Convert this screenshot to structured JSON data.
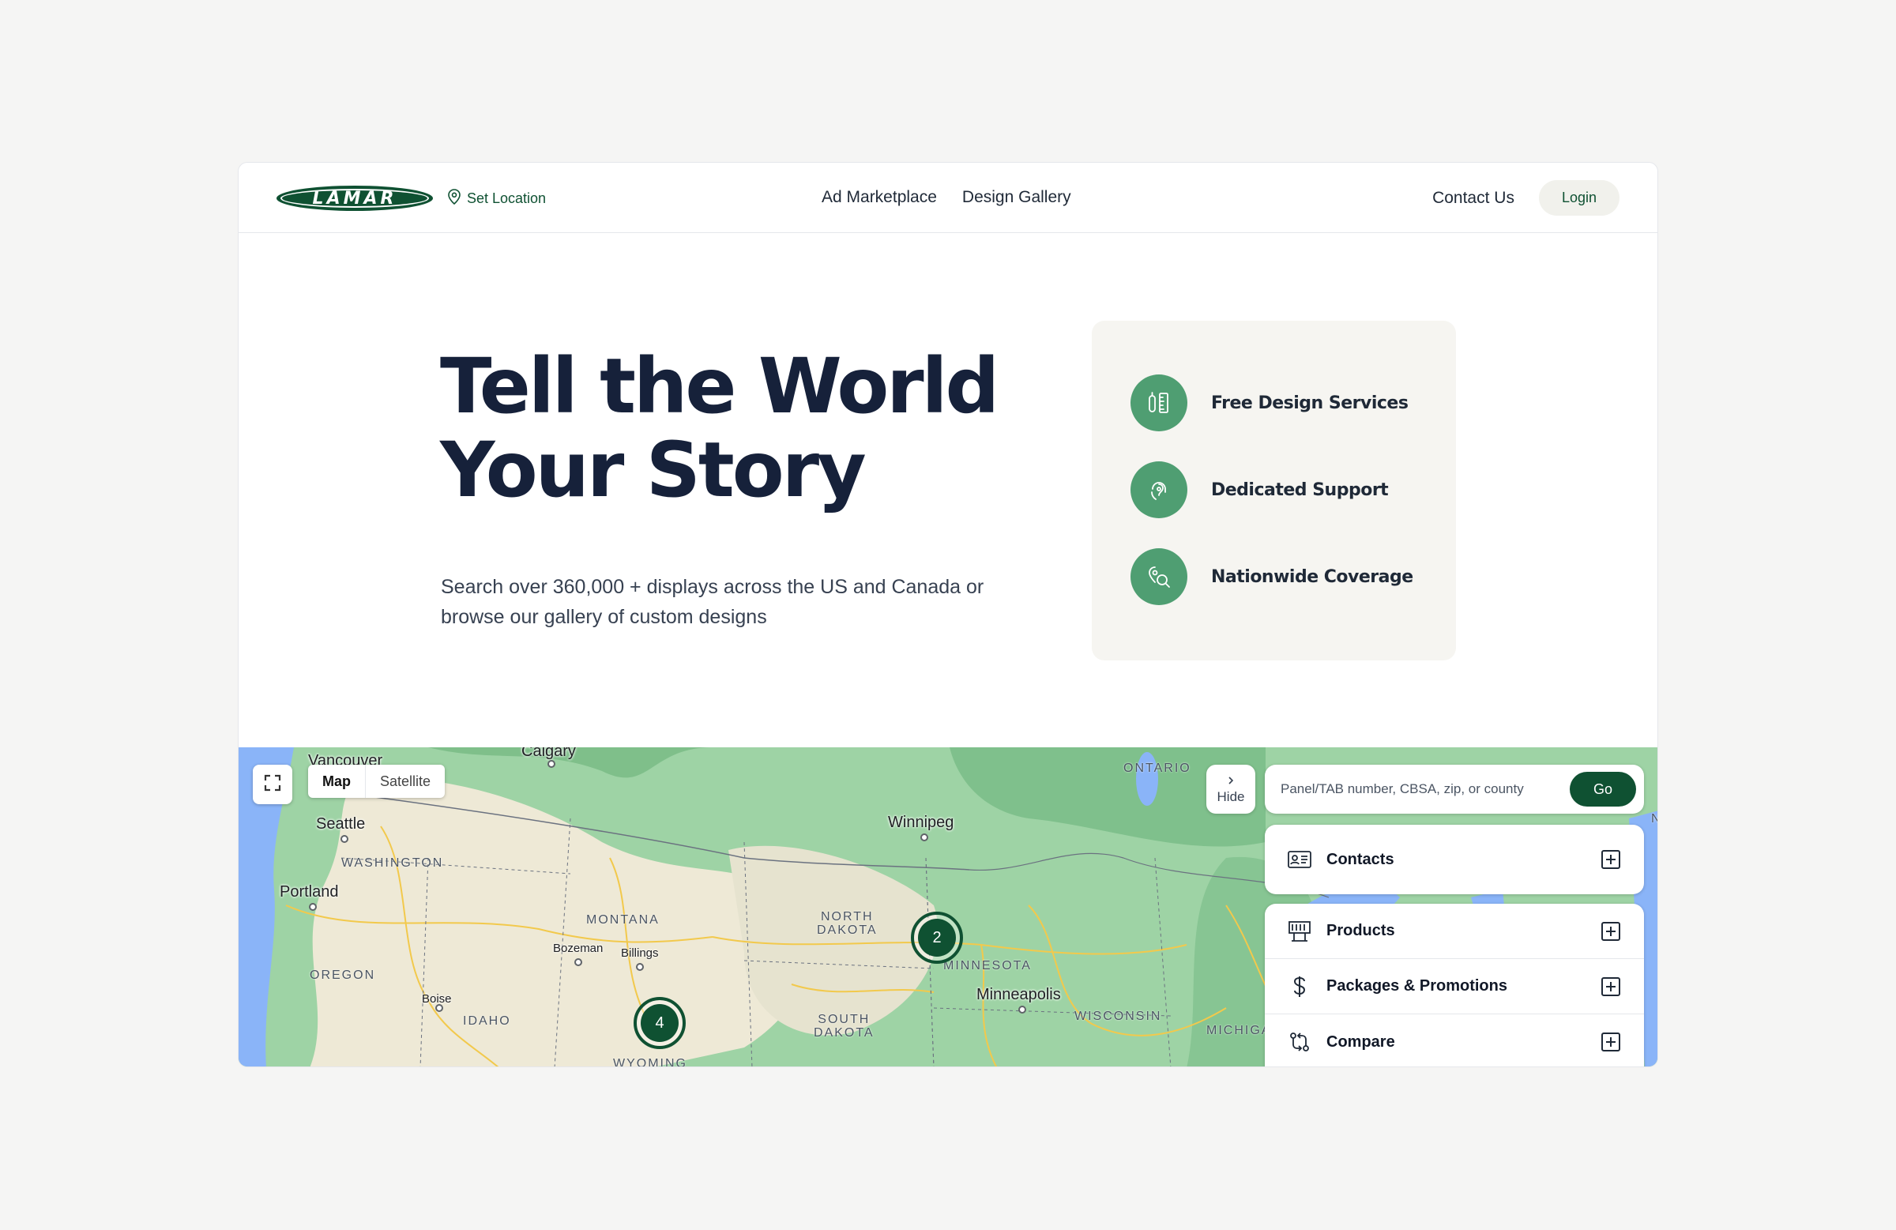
{
  "brand": {
    "logo_text": "LAMAR",
    "color": "#0f5132"
  },
  "nav": {
    "set_location": "Set Location",
    "links": [
      "Ad Marketplace",
      "Design Gallery"
    ],
    "contact": "Contact Us",
    "login": "Login"
  },
  "hero": {
    "headline_line1": "Tell the World",
    "headline_line2": "Your Story",
    "subtext": "Search over 360,000 + displays across the US and Canada or browse our gallery of custom designs"
  },
  "features": [
    {
      "label": "Free Design Services",
      "icon": "design-tools-icon"
    },
    {
      "label": "Dedicated Support",
      "icon": "support-icon"
    },
    {
      "label": "Nationwide Coverage",
      "icon": "location-search-icon"
    }
  ],
  "map": {
    "type_options": [
      "Map",
      "Satellite"
    ],
    "selected_type": "Map",
    "hide_label": "Hide",
    "search_placeholder": "Panel/TAB number, CBSA, zip, or county",
    "go_label": "Go",
    "clusters": [
      "2",
      "4"
    ],
    "labels": {
      "vancouver": "Vancouver",
      "calgary": "Calgary",
      "seattle": "Seattle",
      "washington": "WASHINGTON",
      "portland": "Portland",
      "oregon": "OREGON",
      "boise": "Boise",
      "idaho": "IDAHO",
      "montana": "MONTANA",
      "bozeman": "Bozeman",
      "billings": "Billings",
      "wyoming": "WYOMING",
      "north_dakota": "NORTH\nDAKOTA",
      "south_dakota": "SOUTH\nDAKOTA",
      "winnipeg": "Winnipeg",
      "ontario": "ONTARIO",
      "minnesota": "MINNESOTA",
      "minneapolis": "Minneapolis",
      "wisconsin": "WISCONSIN",
      "michigan": "MICHIGA",
      "new": "NEW"
    }
  },
  "panel": {
    "contacts": "Contacts",
    "products": "Products",
    "packages": "Packages & Promotions",
    "compare": "Compare"
  }
}
